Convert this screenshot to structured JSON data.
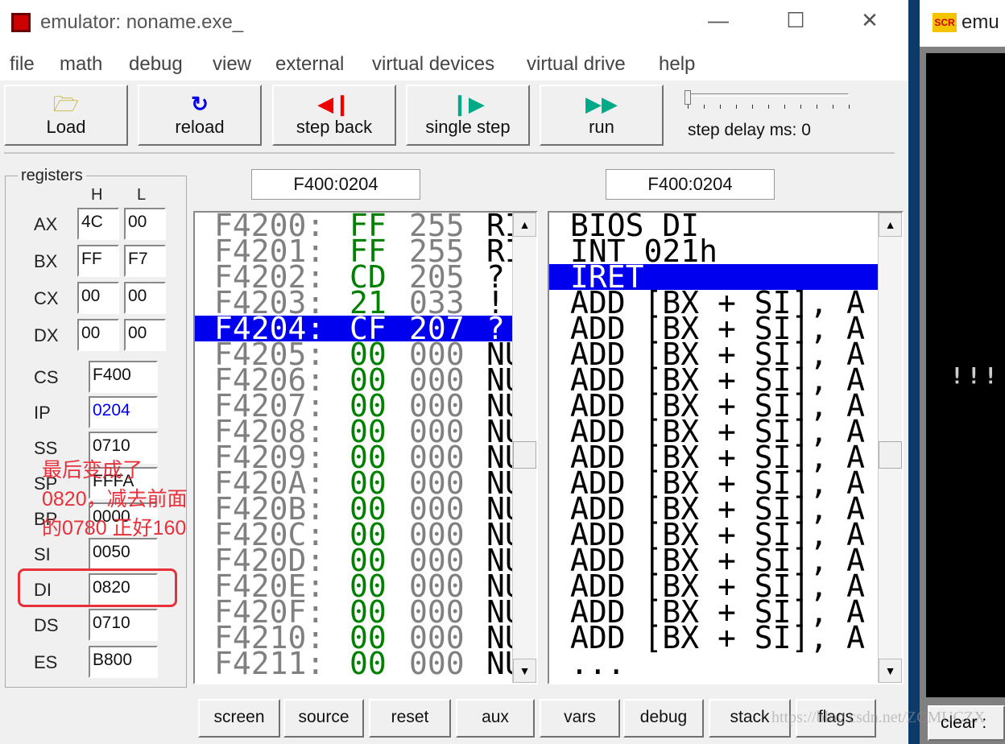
{
  "window": {
    "title": "emulator: noname.exe_",
    "minimize": "—",
    "maximize": "☐",
    "close": "✕"
  },
  "menu": [
    "file",
    "math",
    "debug",
    "view",
    "external",
    "virtual devices",
    "virtual drive",
    "help"
  ],
  "toolbar": {
    "buttons": [
      {
        "label": "Load",
        "icon": "open-folder-icon"
      },
      {
        "label": "reload",
        "icon": "reload-icon"
      },
      {
        "label": "step back",
        "icon": "step-back-icon"
      },
      {
        "label": "single step",
        "icon": "single-step-icon"
      },
      {
        "label": "run",
        "icon": "run-icon"
      }
    ],
    "step_delay_label": "step delay ms: 0",
    "step_delay_value": 0
  },
  "registers": {
    "title": "registers",
    "h": "H",
    "l": "L",
    "general": [
      {
        "name": "AX",
        "h": "4C",
        "l": "00"
      },
      {
        "name": "BX",
        "h": "FF",
        "l": "F7"
      },
      {
        "name": "CX",
        "h": "00",
        "l": "00"
      },
      {
        "name": "DX",
        "h": "00",
        "l": "00"
      }
    ],
    "segment": [
      {
        "name": "CS",
        "value": "F400"
      },
      {
        "name": "IP",
        "value": "0204"
      },
      {
        "name": "SS",
        "value": "0710"
      },
      {
        "name": "SP",
        "value": "FFFA"
      },
      {
        "name": "BP",
        "value": "0000"
      },
      {
        "name": "SI",
        "value": "0050"
      },
      {
        "name": "DI",
        "value": "0820"
      },
      {
        "name": "DS",
        "value": "0710"
      },
      {
        "name": "ES",
        "value": "B800"
      }
    ]
  },
  "annotation": {
    "lines": [
      "最后变成了",
      "0820，减去前面",
      "的0780 正好160"
    ],
    "color": "#e8303a"
  },
  "memory": {
    "address": "F400:0204",
    "selected_index": 4,
    "rows": [
      [
        "F4200:",
        "FF",
        "255",
        "RI"
      ],
      [
        "F4201:",
        "FF",
        "255",
        "RI"
      ],
      [
        "F4202:",
        "CD",
        "205",
        "?"
      ],
      [
        "F4203:",
        "21",
        "033",
        "!"
      ],
      [
        "F4204:",
        "CF",
        "207",
        "?"
      ],
      [
        "F4205:",
        "00",
        "000",
        "NU"
      ],
      [
        "F4206:",
        "00",
        "000",
        "NU"
      ],
      [
        "F4207:",
        "00",
        "000",
        "NU"
      ],
      [
        "F4208:",
        "00",
        "000",
        "NU"
      ],
      [
        "F4209:",
        "00",
        "000",
        "NU"
      ],
      [
        "F420A:",
        "00",
        "000",
        "NU"
      ],
      [
        "F420B:",
        "00",
        "000",
        "NU"
      ],
      [
        "F420C:",
        "00",
        "000",
        "NU"
      ],
      [
        "F420D:",
        "00",
        "000",
        "NU"
      ],
      [
        "F420E:",
        "00",
        "000",
        "NU"
      ],
      [
        "F420F:",
        "00",
        "000",
        "NU"
      ],
      [
        "F4210:",
        "00",
        "000",
        "NU"
      ],
      [
        "F4211:",
        "00",
        "000",
        "NU"
      ]
    ]
  },
  "disasm": {
    "address": "F400:0204",
    "selected_index": 2,
    "rows": [
      "BIOS DI",
      "INT 021h",
      "IRET",
      "ADD [BX + SI], A",
      "ADD [BX + SI], A",
      "ADD [BX + SI], A",
      "ADD [BX + SI], A",
      "ADD [BX + SI], A",
      "ADD [BX + SI], A",
      "ADD [BX + SI], A",
      "ADD [BX + SI], A",
      "ADD [BX + SI], A",
      "ADD [BX + SI], A",
      "ADD [BX + SI], A",
      "ADD [BX + SI], A",
      "ADD [BX + SI], A",
      "ADD [BX + SI], A",
      "..."
    ]
  },
  "bottom_buttons": [
    "screen",
    "source",
    "reset",
    "aux",
    "vars",
    "debug",
    "stack",
    "flags"
  ],
  "screen_window": {
    "icon_text": "SCR",
    "title": "emu",
    "output": "!!!",
    "clear": "clear :"
  },
  "watermark": "https://blog.csdn.net/ZCMUCZX",
  "colors": {
    "selection": "#0000ee",
    "hex": "#008000",
    "address": "#808080",
    "ip": "#0000ee"
  }
}
